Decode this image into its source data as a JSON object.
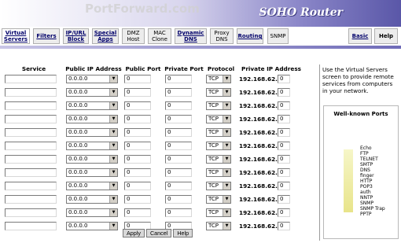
{
  "banner": {
    "title": "SOHO Router"
  },
  "watermark": "PortForward.com",
  "nav": {
    "tabs": [
      {
        "label": "Virtual Servers",
        "lines": [
          "Virtual",
          "Servers"
        ]
      },
      {
        "label": "Filters",
        "lines": [
          "Filters"
        ]
      },
      {
        "label": "IP/URL Block",
        "lines": [
          "IP/URL",
          "Block"
        ]
      },
      {
        "label": "Special Apps",
        "lines": [
          "Special",
          "Apps"
        ]
      },
      {
        "label": "DMZ Host",
        "lines": [
          "DMZ",
          "Host"
        ]
      },
      {
        "label": "MAC Clone",
        "lines": [
          "MAC",
          "Clone"
        ]
      },
      {
        "label": "Dynamic DNS",
        "lines": [
          "Dynamic",
          "DNS"
        ]
      },
      {
        "label": "Proxy DNS",
        "lines": [
          "Proxy",
          "DNS"
        ]
      },
      {
        "label": "Routing",
        "lines": [
          "Routing"
        ]
      },
      {
        "label": "SNMP",
        "lines": [
          "SNMP"
        ]
      }
    ],
    "basic": "Basic",
    "help": "Help"
  },
  "table": {
    "headers": {
      "service": "Service",
      "public_ip": "Public IP Address",
      "public_port": "Public Port",
      "private_port": "Private Port",
      "protocol": "Protocol",
      "private_ip": "Private IP Address"
    },
    "rows": [
      {
        "service": "",
        "public_ip": "0.0.0.0",
        "public_port": "0",
        "private_port": "0",
        "protocol": "TCP",
        "ip_prefix": "192.168.62.",
        "ip_last": "0"
      },
      {
        "service": "",
        "public_ip": "0.0.0.0",
        "public_port": "0",
        "private_port": "0",
        "protocol": "TCP",
        "ip_prefix": "192.168.62.",
        "ip_last": "0"
      },
      {
        "service": "",
        "public_ip": "0.0.0.0",
        "public_port": "0",
        "private_port": "0",
        "protocol": "TCP",
        "ip_prefix": "192.168.62.",
        "ip_last": "0"
      },
      {
        "service": "",
        "public_ip": "0.0.0.0",
        "public_port": "0",
        "private_port": "0",
        "protocol": "TCP",
        "ip_prefix": "192.168.62.",
        "ip_last": "0"
      },
      {
        "service": "",
        "public_ip": "0.0.0.0",
        "public_port": "0",
        "private_port": "0",
        "protocol": "TCP",
        "ip_prefix": "192.168.62.",
        "ip_last": "0"
      },
      {
        "service": "",
        "public_ip": "0.0.0.0",
        "public_port": "0",
        "private_port": "0",
        "protocol": "TCP",
        "ip_prefix": "192.168.62.",
        "ip_last": "0"
      },
      {
        "service": "",
        "public_ip": "0.0.0.0",
        "public_port": "0",
        "private_port": "0",
        "protocol": "TCP",
        "ip_prefix": "192.168.62.",
        "ip_last": "0"
      },
      {
        "service": "",
        "public_ip": "0.0.0.0",
        "public_port": "0",
        "private_port": "0",
        "protocol": "TCP",
        "ip_prefix": "192.168.62.",
        "ip_last": "0"
      },
      {
        "service": "",
        "public_ip": "0.0.0.0",
        "public_port": "0",
        "private_port": "0",
        "protocol": "TCP",
        "ip_prefix": "192.168.62.",
        "ip_last": "0"
      },
      {
        "service": "",
        "public_ip": "0.0.0.0",
        "public_port": "0",
        "private_port": "0",
        "protocol": "TCP",
        "ip_prefix": "192.168.62.",
        "ip_last": "0"
      },
      {
        "service": "",
        "public_ip": "0.0.0.0",
        "public_port": "0",
        "private_port": "0",
        "protocol": "TCP",
        "ip_prefix": "192.168.62.",
        "ip_last": "0"
      },
      {
        "service": "",
        "public_ip": "0.0.0.0",
        "public_port": "0",
        "private_port": "0",
        "protocol": "TCP",
        "ip_prefix": "192.168.62.",
        "ip_last": "0"
      }
    ]
  },
  "buttons": {
    "apply": "Apply",
    "cancel": "Cancel",
    "help": "Help"
  },
  "sidebar": {
    "description": "Use the Virtual Servers screen to provide remote services from computers in your network.",
    "ports_title": "Well-known Ports",
    "ports": [
      "Echo",
      "FTP",
      "TELNET",
      "SMTP",
      "DNS",
      "finger",
      "HTTP",
      "POP3",
      "auth",
      "NNTP",
      "SNMP",
      "SNMP Trap",
      "PPTP"
    ]
  }
}
